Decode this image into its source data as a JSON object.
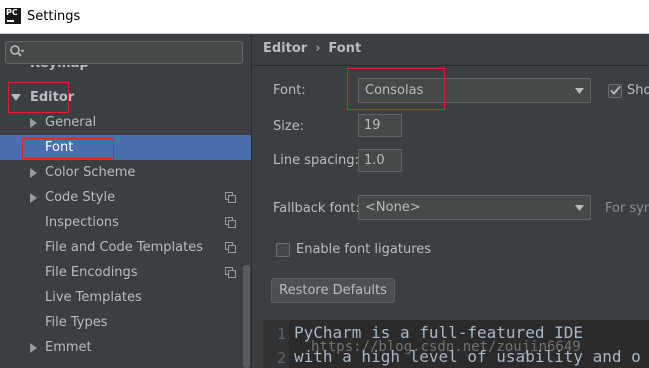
{
  "window": {
    "title": "Settings",
    "app_icon_text": "PC"
  },
  "sidebar": {
    "search_placeholder": "",
    "partial_item": "Keymap",
    "items": [
      {
        "label": "Editor",
        "expanded": true
      },
      {
        "label": "General"
      },
      {
        "label": "Font",
        "selected": true
      },
      {
        "label": "Color Scheme"
      },
      {
        "label": "Code Style"
      },
      {
        "label": "Inspections"
      },
      {
        "label": "File and Code Templates"
      },
      {
        "label": "File Encodings"
      },
      {
        "label": "Live Templates"
      },
      {
        "label": "File Types"
      },
      {
        "label": "Emmet"
      }
    ]
  },
  "content": {
    "breadcrumb": {
      "parent": "Editor",
      "separator": "›",
      "current": "Font"
    },
    "font": {
      "label": "Font:",
      "value": "Consolas",
      "show_label_cut": "Sho"
    },
    "size": {
      "label": "Size:",
      "value": "19"
    },
    "line_spacing": {
      "label": "Line spacing:",
      "value": "1.0"
    },
    "fallback": {
      "label": "Fallback font:",
      "value": "<None>",
      "hint_cut": "For sym"
    },
    "ligatures": {
      "label": "Enable font ligatures",
      "checked": false
    },
    "restore_button": "Restore Defaults",
    "preview": {
      "line1_number": "1",
      "line1": "PyCharm is a full-featured IDE",
      "line2_number": "2",
      "line2": "with a high level of usability and o"
    },
    "watermark": "https://blog.csdn.net/zoujin6649"
  },
  "colors": {
    "background": "#3c3f41",
    "selection": "#4b6eaf",
    "annotation_red": "#e02020",
    "editor_bg": "#2b2b2b"
  }
}
